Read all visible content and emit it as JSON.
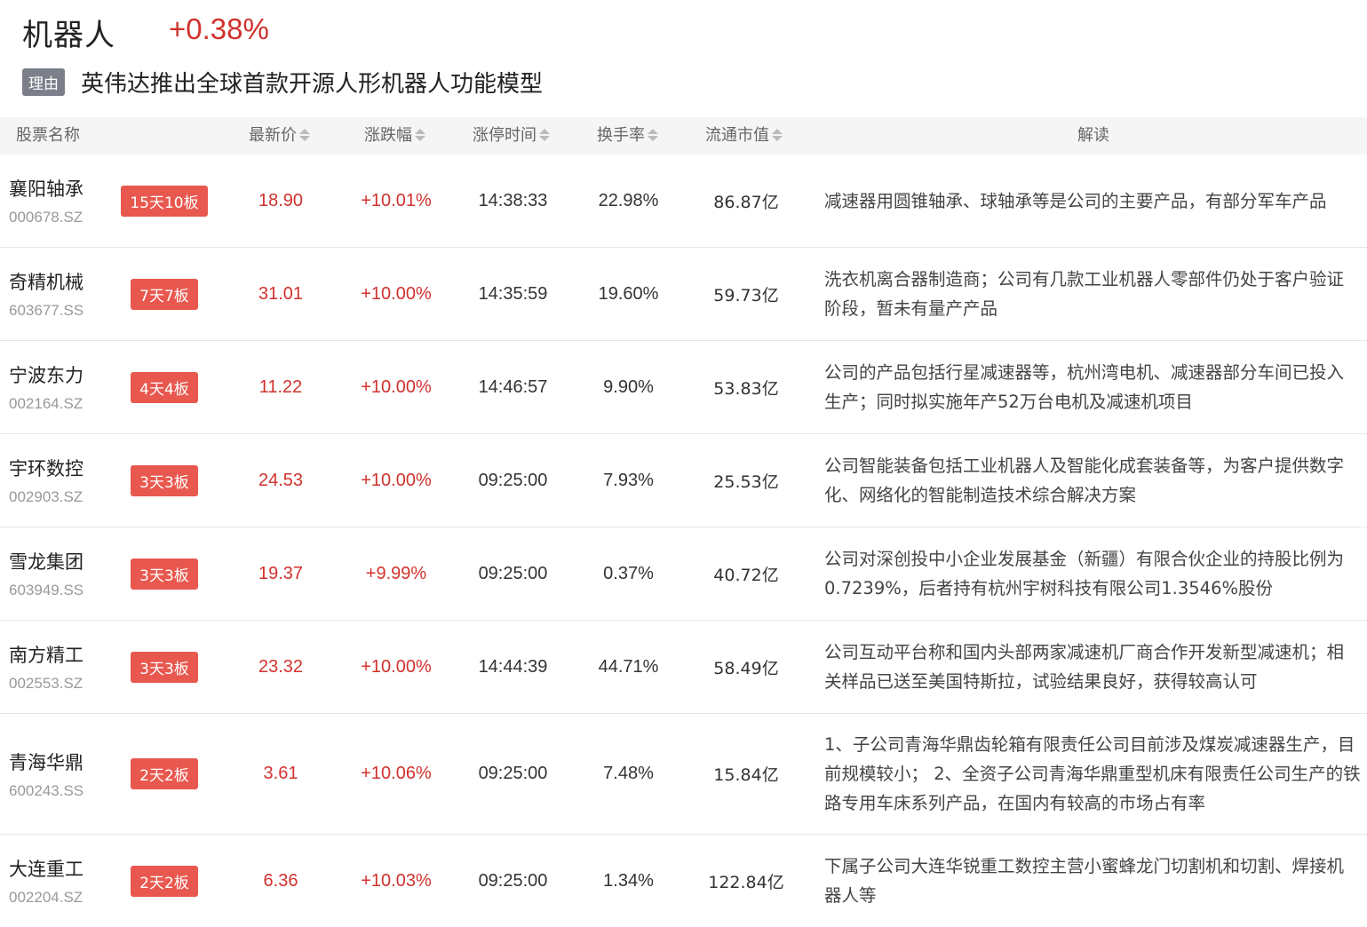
{
  "header": {
    "sector_name": "机器人",
    "sector_change": "+0.38%",
    "reason_tag": "理由",
    "reason_text": "英伟达推出全球首款开源人形机器人功能模型"
  },
  "columns": {
    "name": "股票名称",
    "price": "最新价",
    "change": "涨跌幅",
    "limit_time": "涨停时间",
    "turnover": "换手率",
    "float_cap": "流通市值",
    "desc": "解读"
  },
  "rows": [
    {
      "name": "襄阳轴承",
      "code": "000678.SZ",
      "badge": "15天10板",
      "price": "18.90",
      "change": "+10.01%",
      "time": "14:38:33",
      "turnover": "22.98%",
      "cap": "86.87亿",
      "desc": "减速器用圆锥轴承、球轴承等是公司的主要产品，有部分军车产品"
    },
    {
      "name": "奇精机械",
      "code": "603677.SS",
      "badge": "7天7板",
      "price": "31.01",
      "change": "+10.00%",
      "time": "14:35:59",
      "turnover": "19.60%",
      "cap": "59.73亿",
      "desc": "洗衣机离合器制造商；公司有几款工业机器人零部件仍处于客户验证阶段，暂未有量产产品"
    },
    {
      "name": "宁波东力",
      "code": "002164.SZ",
      "badge": "4天4板",
      "price": "11.22",
      "change": "+10.00%",
      "time": "14:46:57",
      "turnover": "9.90%",
      "cap": "53.83亿",
      "desc": "公司的产品包括行星减速器等，杭州湾电机、减速器部分车间已投入生产；同时拟实施年产52万台电机及减速机项目"
    },
    {
      "name": "宇环数控",
      "code": "002903.SZ",
      "badge": "3天3板",
      "price": "24.53",
      "change": "+10.00%",
      "time": "09:25:00",
      "turnover": "7.93%",
      "cap": "25.53亿",
      "desc": "公司智能装备包括工业机器人及智能化成套装备等，为客户提供数字化、网络化的智能制造技术综合解决方案"
    },
    {
      "name": "雪龙集团",
      "code": "603949.SS",
      "badge": "3天3板",
      "price": "19.37",
      "change": "+9.99%",
      "time": "09:25:00",
      "turnover": "0.37%",
      "cap": "40.72亿",
      "desc": "公司对深创投中小企业发展基金（新疆）有限合伙企业的持股比例为0.7239%，后者持有杭州宇树科技有限公司1.3546%股份"
    },
    {
      "name": "南方精工",
      "code": "002553.SZ",
      "badge": "3天3板",
      "price": "23.32",
      "change": "+10.00%",
      "time": "14:44:39",
      "turnover": "44.71%",
      "cap": "58.49亿",
      "desc": "公司互动平台称和国内头部两家减速机厂商合作开发新型减速机；相关样品已送至美国特斯拉，试验结果良好，获得较高认可"
    },
    {
      "name": "青海华鼎",
      "code": "600243.SS",
      "badge": "2天2板",
      "price": "3.61",
      "change": "+10.06%",
      "time": "09:25:00",
      "turnover": "7.48%",
      "cap": "15.84亿",
      "desc": "1、子公司青海华鼎齿轮箱有限责任公司目前涉及煤炭减速器生产，目前规模较小； 2、全资子公司青海华鼎重型机床有限责任公司生产的铁路专用车床系列产品，在国内有较高的市场占有率"
    },
    {
      "name": "大连重工",
      "code": "002204.SZ",
      "badge": "2天2板",
      "price": "6.36",
      "change": "+10.03%",
      "time": "09:25:00",
      "turnover": "1.34%",
      "cap": "122.84亿",
      "desc": "下属子公司大连华锐重工数控主营小蜜蜂龙门切割机和切割、焊接机器人等"
    }
  ],
  "colors": {
    "up": "#d0322d",
    "badge": "#e8584f",
    "reason_tag": "#7b7f8a"
  }
}
